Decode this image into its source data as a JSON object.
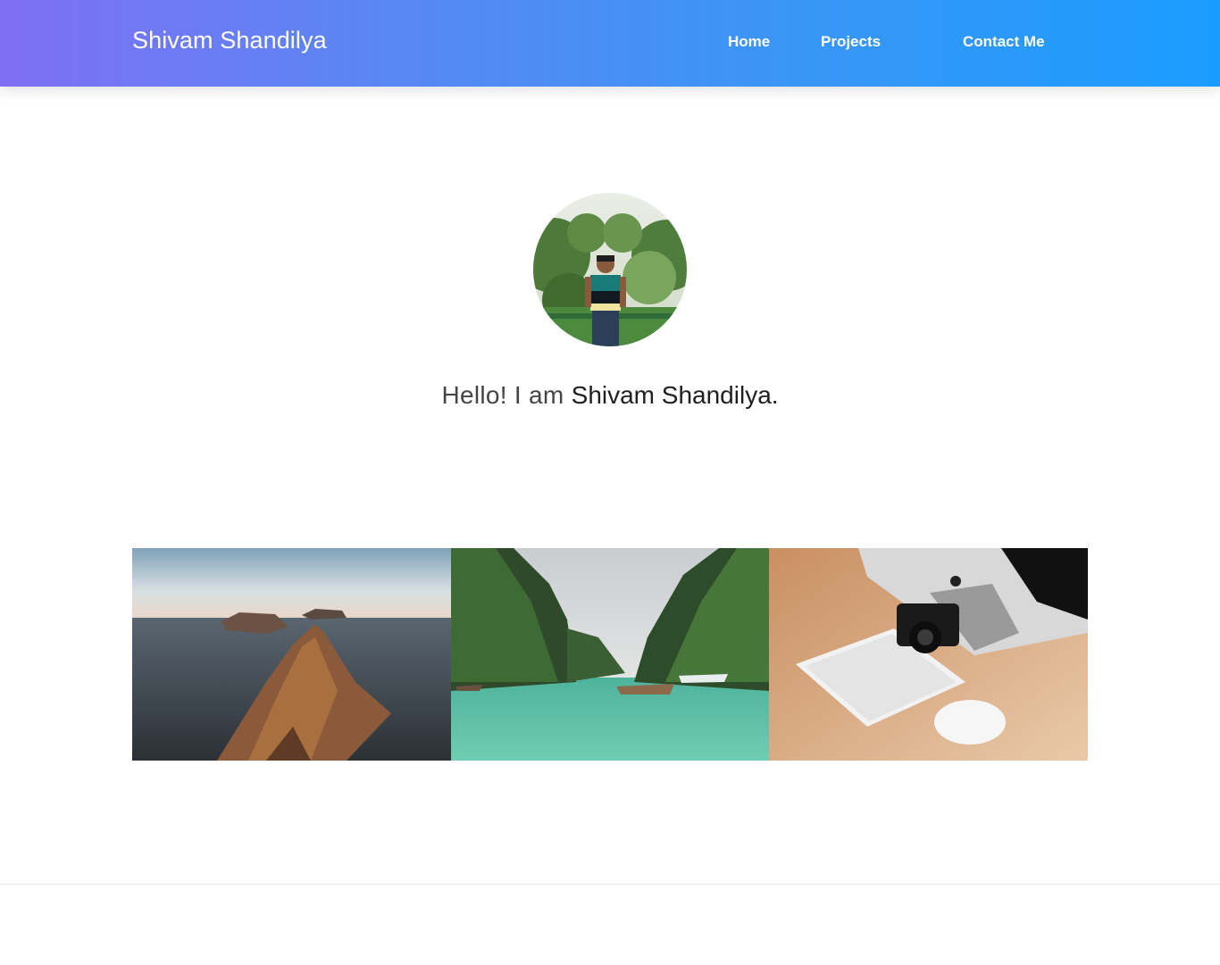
{
  "navbar": {
    "brand": "Shivam Shandilya",
    "links": [
      {
        "label": "Home"
      },
      {
        "label": "Projects"
      },
      {
        "label": "Contact Me"
      }
    ],
    "gradient_start": "#7f6ff5",
    "gradient_end": "#1a9cff"
  },
  "hero": {
    "greeting_prefix": "Hello! I am ",
    "greeting_name": "Shivam Shandilya."
  },
  "gallery": {
    "images": [
      {
        "subject": "rocky-islands-seascape"
      },
      {
        "subject": "lagoon-boats-cliffs"
      },
      {
        "subject": "desk-camera-keyboard-mouse"
      }
    ]
  }
}
